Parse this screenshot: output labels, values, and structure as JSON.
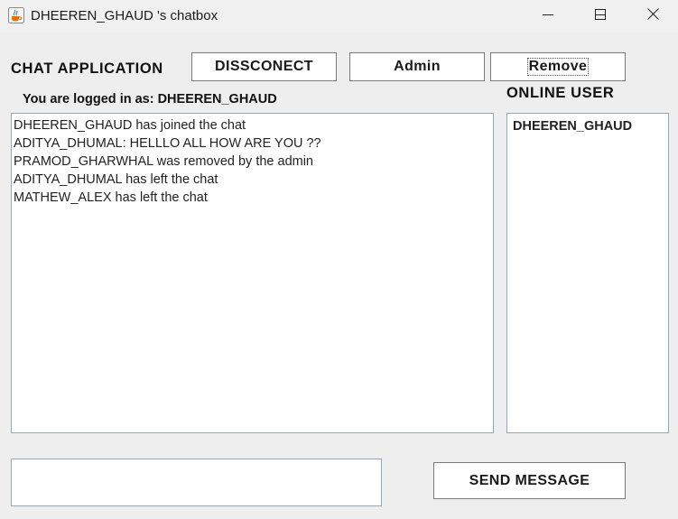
{
  "window": {
    "title": "DHEEREN_GHAUD 's chatbox"
  },
  "header": {
    "app_title": "CHAT APPLICATION",
    "disconnect_label": "DISSCONECT",
    "admin_label": "Admin",
    "remove_label": "Remove",
    "logged_in_text": "You are logged in as: DHEEREN_GHAUD",
    "online_title": "ONLINE USER"
  },
  "chat": {
    "messages": [
      "DHEEREN_GHAUD has joined the chat",
      "ADITYA_DHUMAL: HELLLO ALL HOW ARE YOU ??",
      "PRAMOD_GHARWHAL was removed by the admin",
      "ADITYA_DHUMAL has left the chat",
      "MATHEW_ALEX has left the chat"
    ]
  },
  "online": {
    "users": [
      "DHEEREN_GHAUD"
    ]
  },
  "composer": {
    "value": "",
    "send_label": "SEND MESSAGE"
  },
  "icons": {
    "app": "java-coffee-cup-icon",
    "minimize": "minimize-icon",
    "maximize": "maximize-icon",
    "close": "close-icon"
  }
}
